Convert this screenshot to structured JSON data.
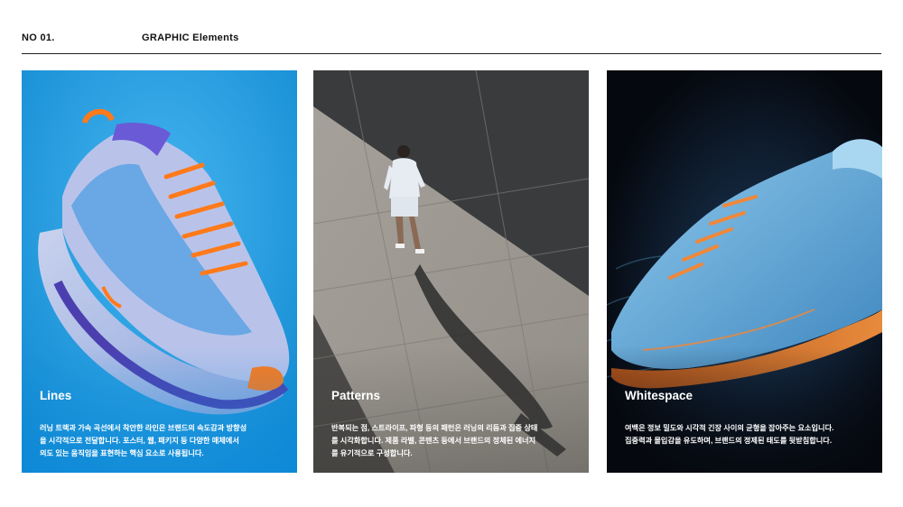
{
  "header": {
    "number": "NO 01.",
    "title": "GRAPHIC Elements"
  },
  "cards": [
    {
      "title": "Lines",
      "description": "러닝 트랙과 가속 곡선에서 착안한 라인은 브랜드의 속도감과 방향성\n을 시각적으로 전달합니다. 포스터, 웹, 패키지 등 다양한 매체에서\n의도 있는 움직임을 표현하는 핵심 요소로 사용됩니다.",
      "image": "running-shoe-lavender-orange-on-blue"
    },
    {
      "title": "Patterns",
      "description": "반복되는 점, 스트라이프, 파형 등의 패턴은 러닝의 리듬과 집중 상태\n를 시각화합니다. 제품 라벨, 콘텐츠 등에서 브랜드의 정체된 에너지\n를 유기적으로 구성합니다.",
      "image": "runner-on-pavement-with-shadow"
    },
    {
      "title": "Whitespace",
      "description": "여백은 정보 밀도와 시각적 긴장 사이의 균형을 잡아주는 요소입니다.\n집중력과 몰입감을 유도하며, 브랜드의 정제된 태도를 뒷받침합니다.",
      "image": "blue-running-shoe-with-smoke-on-dark"
    }
  ],
  "colors": {
    "card1_bg": "#1897d8",
    "card2_bg": "#8d8983",
    "card3_bg": "#070b12",
    "shoe_orange": "#ff7a1a"
  }
}
